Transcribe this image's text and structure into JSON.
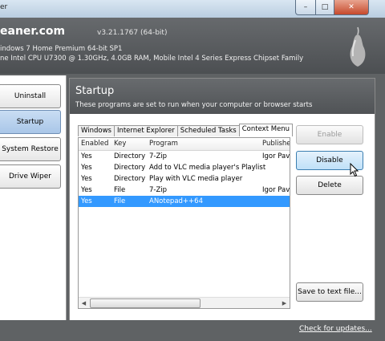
{
  "window": {
    "title_fragment": "er",
    "controls": {
      "minimize": "–",
      "maximize": "□",
      "close": "✕"
    }
  },
  "header": {
    "app_name": "eaner.com",
    "version": "v3.21.1767 (64-bit)",
    "sysinfo_os": "indows 7 Home Premium 64-bit SP1",
    "sysinfo_hw": "ne Intel CPU U7300 @ 1.30GHz, 4.0GB RAM, Mobile Intel 4 Series Express Chipset Family",
    "logo_icon": "pear-icon"
  },
  "nav": {
    "items": [
      {
        "label": "Uninstall"
      },
      {
        "label": "Startup",
        "active": true
      },
      {
        "label": "System Restore"
      },
      {
        "label": "Drive Wiper"
      }
    ]
  },
  "startup": {
    "title": "Startup",
    "subtitle": "These programs are set to run when your computer or browser starts",
    "tabs": [
      {
        "label": "Windows"
      },
      {
        "label": "Internet Explorer"
      },
      {
        "label": "Scheduled Tasks"
      },
      {
        "label": "Context Menu",
        "active": true
      }
    ],
    "columns": [
      "Enabled",
      "Key",
      "Program",
      "Publishe"
    ],
    "rows": [
      {
        "enabled": "Yes",
        "key": "Directory",
        "program": "7-Zip",
        "publisher": "Igor Pav"
      },
      {
        "enabled": "Yes",
        "key": "Directory",
        "program": "Add to VLC media player's Playlist",
        "publisher": ""
      },
      {
        "enabled": "Yes",
        "key": "Directory",
        "program": "Play with VLC media player",
        "publisher": ""
      },
      {
        "enabled": "Yes",
        "key": "File",
        "program": "7-Zip",
        "publisher": "Igor Pav"
      },
      {
        "enabled": "Yes",
        "key": "File",
        "program": "ANotepad++64",
        "publisher": "",
        "selected": true
      }
    ],
    "buttons": {
      "enable": "Enable",
      "disable": "Disable",
      "delete": "Delete",
      "save": "Save to text file..."
    },
    "scroll_arrows": {
      "left": "◀",
      "right": "▶"
    }
  },
  "footer": {
    "update_link": "Check for updates..."
  },
  "colors": {
    "header_bg": "#5f6264",
    "selection": "#3399ff",
    "active_nav": "#b7d0ee"
  }
}
